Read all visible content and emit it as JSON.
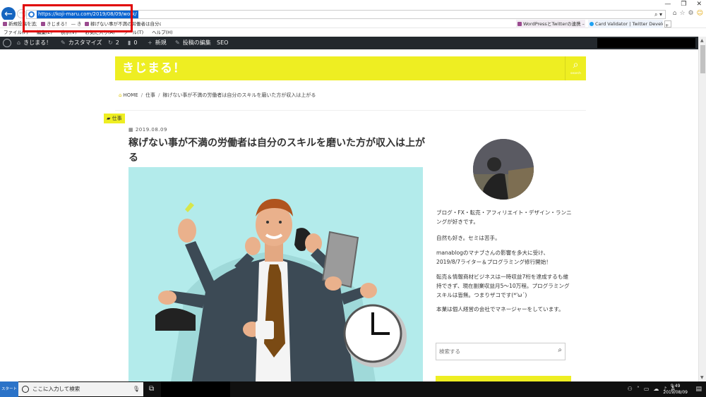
{
  "browser": {
    "url": "https://koji-maru.com/2019/08/09/work/",
    "search_dropdown": "⌕ ▾",
    "window_controls": [
      "—",
      "❐",
      "✕"
    ],
    "toolbar_icons": [
      "⌂",
      "☆",
      "⚙",
      "☺"
    ],
    "tabs": [
      {
        "label": "新規投稿を追加"
      },
      {
        "label": "きじまる！ — きじまる！"
      },
      {
        "label": "稼げない事が不満の労働者は自分のスキル..."
      },
      {
        "label": "WordPressとTwitterの連携 – ..."
      },
      {
        "label": "Card Validator | Twitter Develop..."
      }
    ],
    "new_tab": "+",
    "menu": [
      "ファイル(F)",
      "編集(E)",
      "表示(V)",
      "お気に入り(A)",
      "ツール(T)",
      "ヘルプ(H)"
    ]
  },
  "wp_admin": {
    "site_name": "きじまる！",
    "customize": "カスタマイズ",
    "updates_count": "2",
    "comments_count": "0",
    "new_label": "新規",
    "edit_label": "投稿の編集",
    "seo_label": "SEO"
  },
  "site": {
    "title": "きじまる！",
    "search_label": "search"
  },
  "breadcrumb": {
    "home": "HOME",
    "category": "仕事",
    "current": "稼げない事が不満の労働者は自分のスキルを磨いた方が収入は上がる"
  },
  "article": {
    "category": "仕事",
    "date": "2019.08.09",
    "title": "稼げない事が不満の労働者は自分のスキルを磨いた方が収入は上がる"
  },
  "sidebar": {
    "bio": [
      "ブログ・FX・転売・アフィリエイト・デザイン・ランニングが好きです。",
      "自然も好き。セミは苦手。",
      "manablogのマナブさんの影響を多大に受け、2019/8/7ライター＆プログラミング修行開始！",
      "転売＆情報商材ビジネスは一時収益7桁を達成するも維持できず、現在副業収益月5〜10万程。プログラミングスキルは皆無。つまりザコです(*'ω´)",
      "本業は個人経営の会社でマネージャーをしています。"
    ],
    "search_placeholder": "検索する"
  },
  "taskbar": {
    "start_label": "スタート",
    "search_text": "ここに入力して検索",
    "time": "9:49",
    "date": "2019/08/09",
    "ime": "A"
  },
  "colors": {
    "accent": "#eeee22",
    "wp_bar": "#23282d",
    "hero_bg": "#b3ebeb",
    "highlight_box": "#e00000"
  }
}
